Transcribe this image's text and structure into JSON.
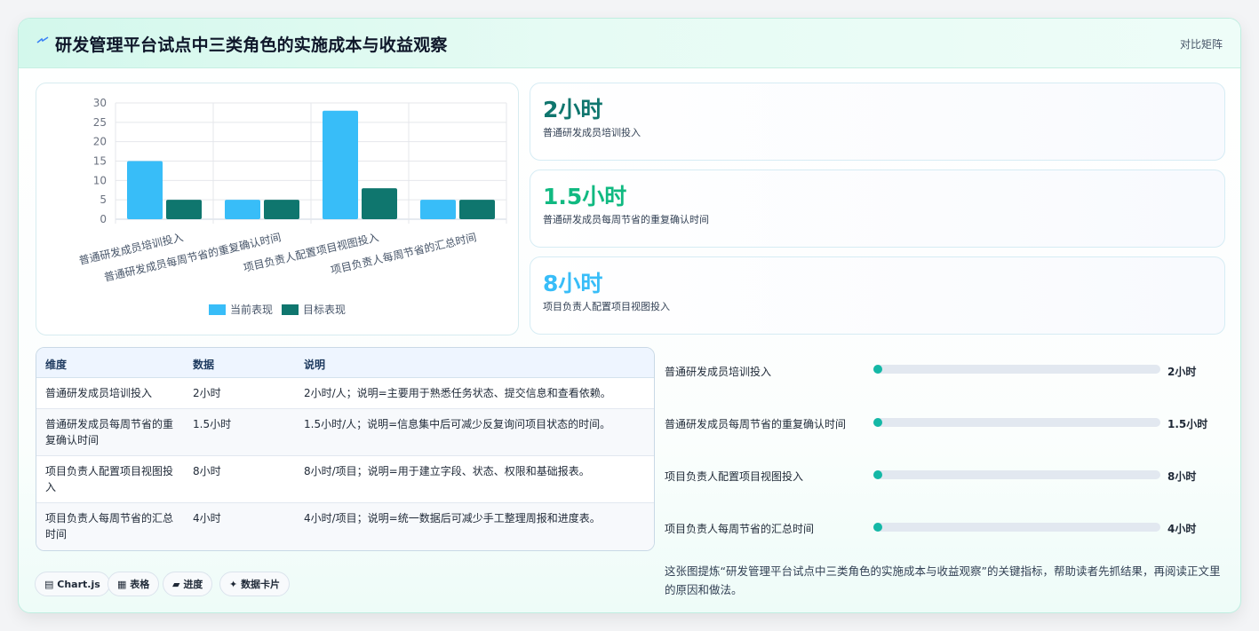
{
  "header": {
    "title": "研发管理平台试点中三类角色的实施成本与收益观察",
    "right_label": "对比矩阵",
    "icon": "lightning-icon"
  },
  "chart_data": {
    "type": "bar",
    "categories": [
      "普通研发成员培训投入",
      "普通研发成员每周节省的重复确认时间",
      "项目负责人配置项目视图投入",
      "项目负责人每周节省的汇总时间"
    ],
    "series": [
      {
        "name": "当前表现",
        "values": [
          15,
          5,
          28,
          5
        ],
        "color": "#38bdf8"
      },
      {
        "name": "目标表现",
        "values": [
          5,
          5,
          8,
          5
        ],
        "color": "#0f766e"
      }
    ],
    "yticks": [
      "0",
      "5",
      "10",
      "15",
      "20",
      "25",
      "30"
    ],
    "ylim": [
      0,
      30
    ],
    "grid": true,
    "legend": "bottom"
  },
  "stats": [
    {
      "value": "2小时",
      "label": "普通研发成员培训投入",
      "color": "#0f766e"
    },
    {
      "value": "1.5小时",
      "label": "普通研发成员每周节省的重复确认时间",
      "color": "#10b981"
    },
    {
      "value": "8小时",
      "label": "项目负责人配置项目视图投入",
      "color": "#38bdf8"
    }
  ],
  "table": {
    "headers": [
      "维度",
      "数据",
      "说明"
    ],
    "rows": [
      {
        "dim1": "普通研发成员培训投入",
        "dim2": "",
        "data": "2小时",
        "note": "2小时/人；说明=主要用于熟悉任务状态、提交信息和查看依赖。"
      },
      {
        "dim1": "普通研发成员每周节省的重",
        "dim2": "复确认时间",
        "data": "1.5小时",
        "note": "1.5小时/人；说明=信息集中后可减少反复询问项目状态的时间。"
      },
      {
        "dim1": "项目负责人配置项目视图投",
        "dim2": "入",
        "data": "8小时",
        "note": "8小时/项目；说明=用于建立字段、状态、权限和基础报表。"
      },
      {
        "dim1": "项目负责人每周节省的汇总",
        "dim2": "时间",
        "data": "4小时",
        "note": "4小时/项目；说明=统一数据后可减少手工整理周报和进度表。"
      }
    ]
  },
  "progress": [
    {
      "label": "普通研发成员培训投入",
      "value": "2小时",
      "fraction": 0.0
    },
    {
      "label": "普通研发成员每周节省的重复确认时间",
      "value": "1.5小时",
      "fraction": 0.0
    },
    {
      "label": "项目负责人配置项目视图投入",
      "value": "8小时",
      "fraction": 0.0
    },
    {
      "label": "项目负责人每周节省的汇总时间",
      "value": "4小时",
      "fraction": 0.0
    }
  ],
  "description": "这张图提炼“研发管理平台试点中三类角色的实施成本与收益观察”的关键指标，帮助读者先抓结果，再阅读正文里的原因和做法。",
  "chips": [
    {
      "label": "Chart.js",
      "icon": "chart-icon"
    },
    {
      "label": "表格",
      "icon": "table-icon"
    },
    {
      "label": "进度",
      "icon": "folder-icon"
    },
    {
      "label": "数据卡片",
      "icon": "sparkle-icon"
    }
  ]
}
